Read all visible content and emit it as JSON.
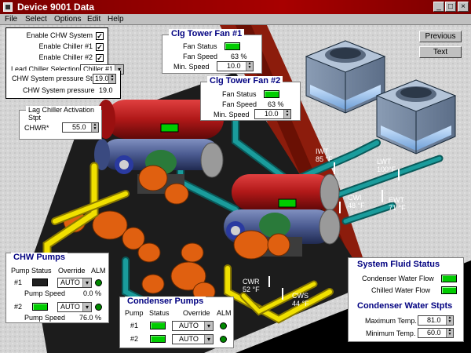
{
  "window": {
    "title": "Device 9001 Data"
  },
  "menu": [
    "File",
    "Select",
    "Options",
    "Edit",
    "Help"
  ],
  "nav": {
    "previous": "Previous",
    "text": "Text"
  },
  "system": {
    "enable_chw_label": "Enable CHW System",
    "enable_chiller1_label": "Enable Chiller #1",
    "enable_chiller2_label": "Enable Chiller #2",
    "lead_chiller_label": "Lead Chiller Selection",
    "lead_chiller_value": "Chiller #1",
    "chw_pressure_stpt_label": "CHW System pressure Stpt",
    "chw_pressure_stpt_value": "19.0",
    "chw_pressure_label": "CHW System pressure",
    "chw_pressure_value": "19.0",
    "check_mark": "✓"
  },
  "lag_chiller": {
    "title": "Lag Chiller Activation Stpt",
    "label": "CHWR*",
    "value": "55.0"
  },
  "tower_fan1": {
    "title": "Clg Tower Fan  #1",
    "status_label": "Fan Status",
    "speed_label": "Fan Speed",
    "speed_value": "63 %",
    "min_speed_label": "Min. Speed",
    "min_speed_value": "10.0"
  },
  "tower_fan2": {
    "title": "Clg Tower Fan  #2",
    "status_label": "Fan Status",
    "speed_label": "Fan Speed",
    "speed_value": "63 %",
    "min_speed_label": "Min. Speed",
    "min_speed_value": "10.0"
  },
  "chw_pumps": {
    "title": "CHW Pumps",
    "headers": [
      "Pump",
      "Status",
      "Override",
      "ALM"
    ],
    "pump1": {
      "id": "#1",
      "override": "AUTO",
      "speed_label": "Pump Speed",
      "speed_value": "0.0 %"
    },
    "pump2": {
      "id": "#2",
      "override": "AUTO",
      "speed_label": "Pump Speed",
      "speed_value": "76.0 %"
    }
  },
  "condenser_pumps": {
    "title": "Condenser Pumps",
    "headers": [
      "Pump",
      "Status",
      "Override",
      "ALM"
    ],
    "pump1": {
      "id": "#1",
      "override": "AUTO"
    },
    "pump2": {
      "id": "#2",
      "override": "AUTO"
    }
  },
  "fluid_status": {
    "title": "System Fluid Status",
    "condenser_label": "Condenser Water Flow",
    "chilled_label": "Chilled Water Flow"
  },
  "condenser_stpts": {
    "title": "Condenser Water Stpts",
    "max_label": "Maximum Temp.",
    "max_value": "81.0",
    "min_label": "Minimum Temp.",
    "min_value": "60.0"
  },
  "sensors": {
    "iwt": {
      "name": "IWT",
      "value": "85 °F"
    },
    "lwt": {
      "name": "LWT",
      "value": "100°F"
    },
    "cwi": {
      "name": "CWI",
      "value": "48 °F"
    },
    "ewt": {
      "name": "EWT",
      "value": "71 °F"
    },
    "cwr": {
      "name": "CWR",
      "value": "52 °F"
    },
    "cws": {
      "name": "CWS",
      "value": "44 °F"
    }
  },
  "colors": {
    "titlebar": "#a80000",
    "roof": "#d8d8d8",
    "wall": "#8c1c0c",
    "pipe_teal": "#1a8c8c",
    "pipe_yellow": "#f0e000",
    "chiller_red": "#b81818",
    "pump_orange": "#e06010",
    "indicator_green": "#00cc00"
  }
}
